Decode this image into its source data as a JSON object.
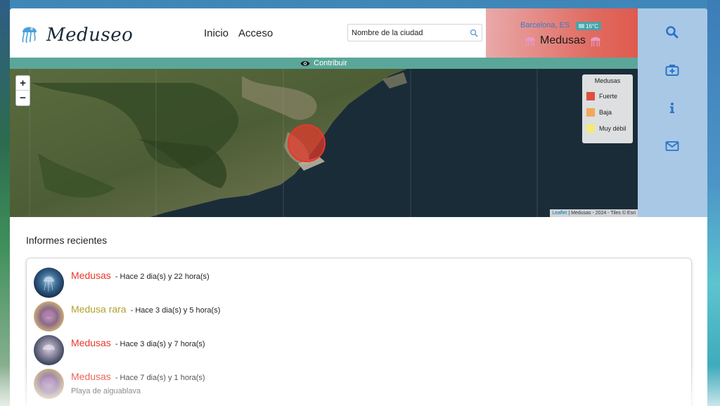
{
  "header": {
    "logo_text": "Meduseo",
    "nav": [
      {
        "label": "Inicio"
      },
      {
        "label": "Acceso"
      }
    ],
    "search": {
      "placeholder": "Nombre de la ciudad",
      "value": ""
    }
  },
  "weather": {
    "city": "Barcelona, ES",
    "temperature": "16°C",
    "status": "Medusas"
  },
  "contribute": {
    "label": "Contribuir"
  },
  "map": {
    "zoom_in": "+",
    "zoom_out": "−",
    "legend": {
      "title": "Medusas",
      "items": [
        {
          "label": "Fuerte",
          "color": "#e04f3e"
        },
        {
          "label": "Baja",
          "color": "#f0a85a"
        },
        {
          "label": "Muy débil",
          "color": "#f3ea7a"
        }
      ]
    },
    "attribution": {
      "leaflet": "Leaflet",
      "rest": "| Medusas - 2024 - Tiles © Esri"
    },
    "marker_color": "#e8382b"
  },
  "sidebar": {
    "icons": [
      "search-icon",
      "first-aid-kit-icon",
      "info-icon",
      "envelope-icon"
    ],
    "icon_color": "#2a73c9"
  },
  "reports": {
    "title": "Informes recientes",
    "items": [
      {
        "type": "Medusas",
        "color": "#e8382b",
        "time": "- Hace 2 dia(s) y 22 hora(s)",
        "note": ""
      },
      {
        "type": "Medusa rara",
        "color": "#b3a12a",
        "time": "- Hace 3 dia(s) y 5 hora(s)",
        "note": ""
      },
      {
        "type": "Medusas",
        "color": "#e8382b",
        "time": "- Hace 3 dia(s) y 7 hora(s)",
        "note": ""
      },
      {
        "type": "Medusas",
        "color": "#e8382b",
        "time": "- Hace 7 dia(s) y 1 hora(s)",
        "note": "Playa de aiguablava"
      }
    ]
  }
}
